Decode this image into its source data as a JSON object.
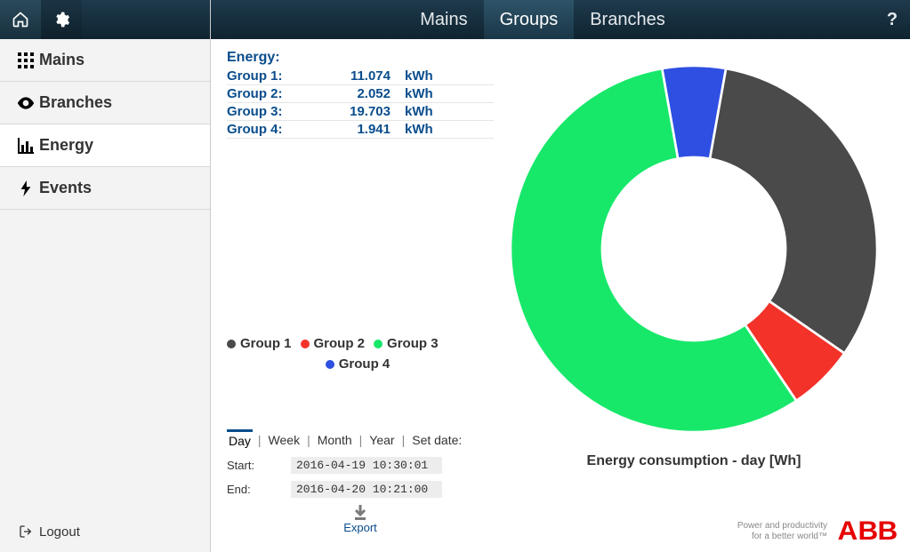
{
  "sidebar": {
    "items": [
      {
        "label": "Mains"
      },
      {
        "label": "Branches"
      },
      {
        "label": "Energy"
      },
      {
        "label": "Events"
      }
    ],
    "logout_label": "Logout"
  },
  "topbar": {
    "tabs": [
      {
        "label": "Mains"
      },
      {
        "label": "Groups"
      },
      {
        "label": "Branches"
      }
    ],
    "help": "?"
  },
  "energy": {
    "heading": "Energy:",
    "rows": [
      {
        "label": "Group 1:",
        "value": "11.074",
        "unit": "kWh"
      },
      {
        "label": "Group 2:",
        "value": "2.052",
        "unit": "kWh"
      },
      {
        "label": "Group 3:",
        "value": "19.703",
        "unit": "kWh"
      },
      {
        "label": "Group 4:",
        "value": "1.941",
        "unit": "kWh"
      }
    ]
  },
  "legend": {
    "items": [
      {
        "label": "Group 1",
        "color": "#4a4a4a"
      },
      {
        "label": "Group 2",
        "color": "#f3322a"
      },
      {
        "label": "Group 3",
        "color": "#17e86a"
      },
      {
        "label": "Group 4",
        "color": "#2e4fe2"
      }
    ]
  },
  "range": {
    "tabs": [
      "Day",
      "Week",
      "Month",
      "Year",
      "Set date:"
    ],
    "active_index": 0
  },
  "dates": {
    "start_label": "Start:",
    "start_value": "2016-04-19 10:30:01",
    "end_label": "End:",
    "end_value": "2016-04-20 10:21:00"
  },
  "export_label": "Export",
  "chart_title": "Energy consumption - day [Wh]",
  "footer": {
    "tagline_line1": "Power and productivity",
    "tagline_line2": "for a better world™",
    "brand": "ABB"
  },
  "chart_data": {
    "type": "pie",
    "title": "Energy consumption - day [Wh]",
    "series": [
      {
        "name": "Group 1",
        "value": 11.074,
        "color": "#4a4a4a"
      },
      {
        "name": "Group 2",
        "value": 2.052,
        "color": "#f3322a"
      },
      {
        "name": "Group 3",
        "value": 19.703,
        "color": "#17e86a"
      },
      {
        "name": "Group 4",
        "value": 1.941,
        "color": "#2e4fe2"
      }
    ]
  }
}
